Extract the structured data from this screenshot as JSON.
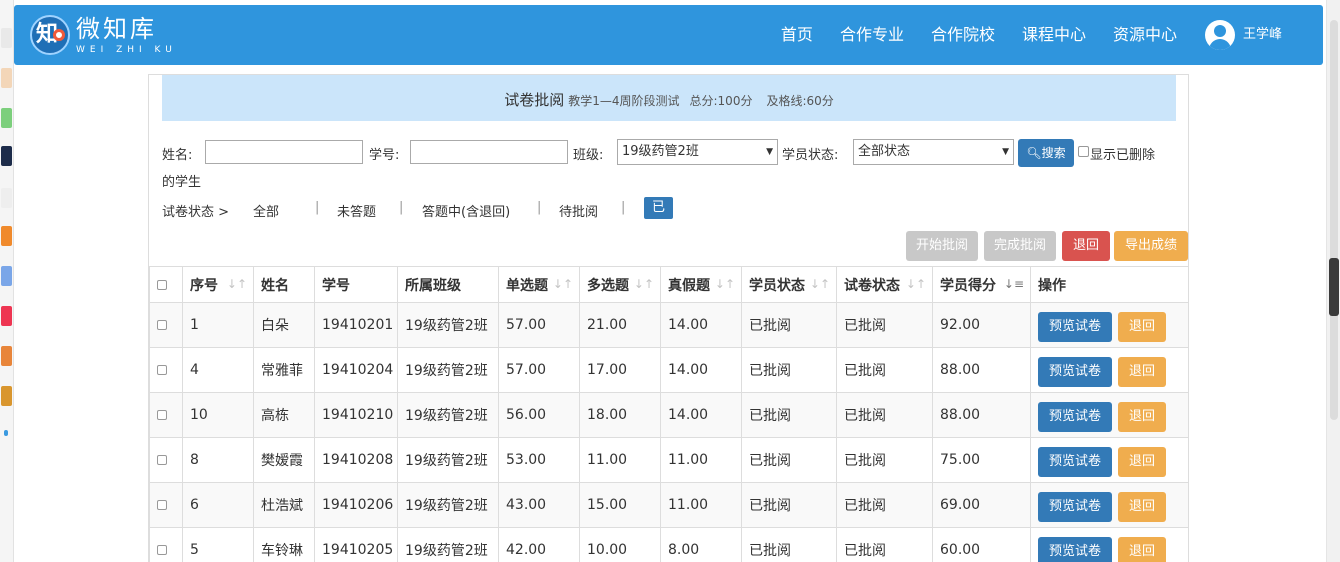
{
  "navbar": {
    "logo_text": "微知库",
    "logo_sub": "WEI ZHI KU",
    "logo_glyph": "知",
    "links": [
      "首页",
      "合作专业",
      "合作院校",
      "课程中心",
      "资源中心"
    ],
    "user_name": "王学峰"
  },
  "title_bar": {
    "title": "试卷批阅",
    "exam": "教学1—4周阶段测试",
    "total": "总分:100分",
    "pass": "及格线:60分"
  },
  "filters": {
    "name_label": "姓名:",
    "name_value": "",
    "id_label": "学号:",
    "id_value": "",
    "class_label": "班级:",
    "class_value": "19级药管2班",
    "status_label": "学员状态:",
    "status_value": "全部状态",
    "search_label": "搜索",
    "show_deleted_line1": "显示已删除",
    "show_deleted_line2": "的学生"
  },
  "paper_status": {
    "label": "试卷状态 >",
    "items": [
      "全部",
      "未答题",
      "答题中(含退回)",
      "待批阅",
      "已批阅"
    ],
    "active_index": 4
  },
  "actions": {
    "start": "开始批阅",
    "finish": "完成批阅",
    "return": "退回",
    "export": "导出成绩"
  },
  "colors": {
    "primary": "#337ab7",
    "warning": "#f0ad4e",
    "danger": "#d9534f",
    "disabled": "#c8c8c8",
    "navbar": "#2f95dd",
    "title_bg": "#cbe5fa"
  },
  "table": {
    "columns": [
      "序号",
      "姓名",
      "学号",
      "所属班级",
      "单选题",
      "多选题",
      "真假题",
      "学员状态",
      "试卷状态",
      "学员得分",
      "操作"
    ],
    "preview_label": "预览试卷",
    "return_label": "退回",
    "rows": [
      {
        "no": "1",
        "name": "白朵",
        "id": "19410201",
        "cls": "19级药管2班",
        "single": "57.00",
        "multi": "21.00",
        "tf": "14.00",
        "stu_status": "已批阅",
        "paper_status": "已批阅",
        "score": "92.00"
      },
      {
        "no": "4",
        "name": "常雅菲",
        "id": "19410204",
        "cls": "19级药管2班",
        "single": "57.00",
        "multi": "17.00",
        "tf": "14.00",
        "stu_status": "已批阅",
        "paper_status": "已批阅",
        "score": "88.00"
      },
      {
        "no": "10",
        "name": "高栋",
        "id": "19410210",
        "cls": "19级药管2班",
        "single": "56.00",
        "multi": "18.00",
        "tf": "14.00",
        "stu_status": "已批阅",
        "paper_status": "已批阅",
        "score": "88.00"
      },
      {
        "no": "8",
        "name": "樊嫒霞",
        "id": "19410208",
        "cls": "19级药管2班",
        "single": "53.00",
        "multi": "11.00",
        "tf": "11.00",
        "stu_status": "已批阅",
        "paper_status": "已批阅",
        "score": "75.00"
      },
      {
        "no": "6",
        "name": "杜浩斌",
        "id": "19410206",
        "cls": "19级药管2班",
        "single": "43.00",
        "multi": "15.00",
        "tf": "11.00",
        "stu_status": "已批阅",
        "paper_status": "已批阅",
        "score": "69.00"
      },
      {
        "no": "5",
        "name": "车铃琳",
        "id": "19410205",
        "cls": "19级药管2班",
        "single": "42.00",
        "multi": "10.00",
        "tf": "8.00",
        "stu_status": "已批阅",
        "paper_status": "已批阅",
        "score": "60.00"
      }
    ]
  }
}
